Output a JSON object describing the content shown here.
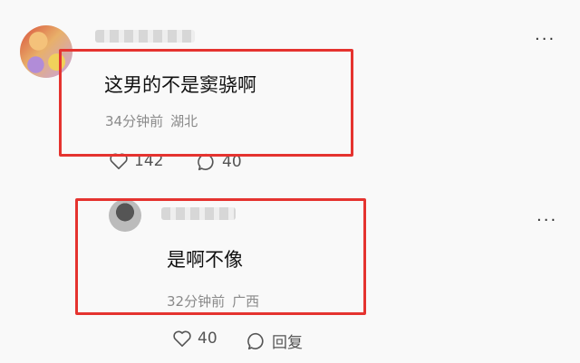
{
  "comments": [
    {
      "text": "这男的不是窦骁啊",
      "time": "34分钟前",
      "location": "湖北",
      "likes": "142",
      "replies": "40"
    },
    {
      "text": "是啊不像",
      "time": "32分钟前",
      "location": "广西",
      "likes": "40",
      "reply_label": "回复"
    }
  ],
  "more_label": "···",
  "colors": {
    "highlight": "#e5332f",
    "meta": "#8a8a8a"
  }
}
